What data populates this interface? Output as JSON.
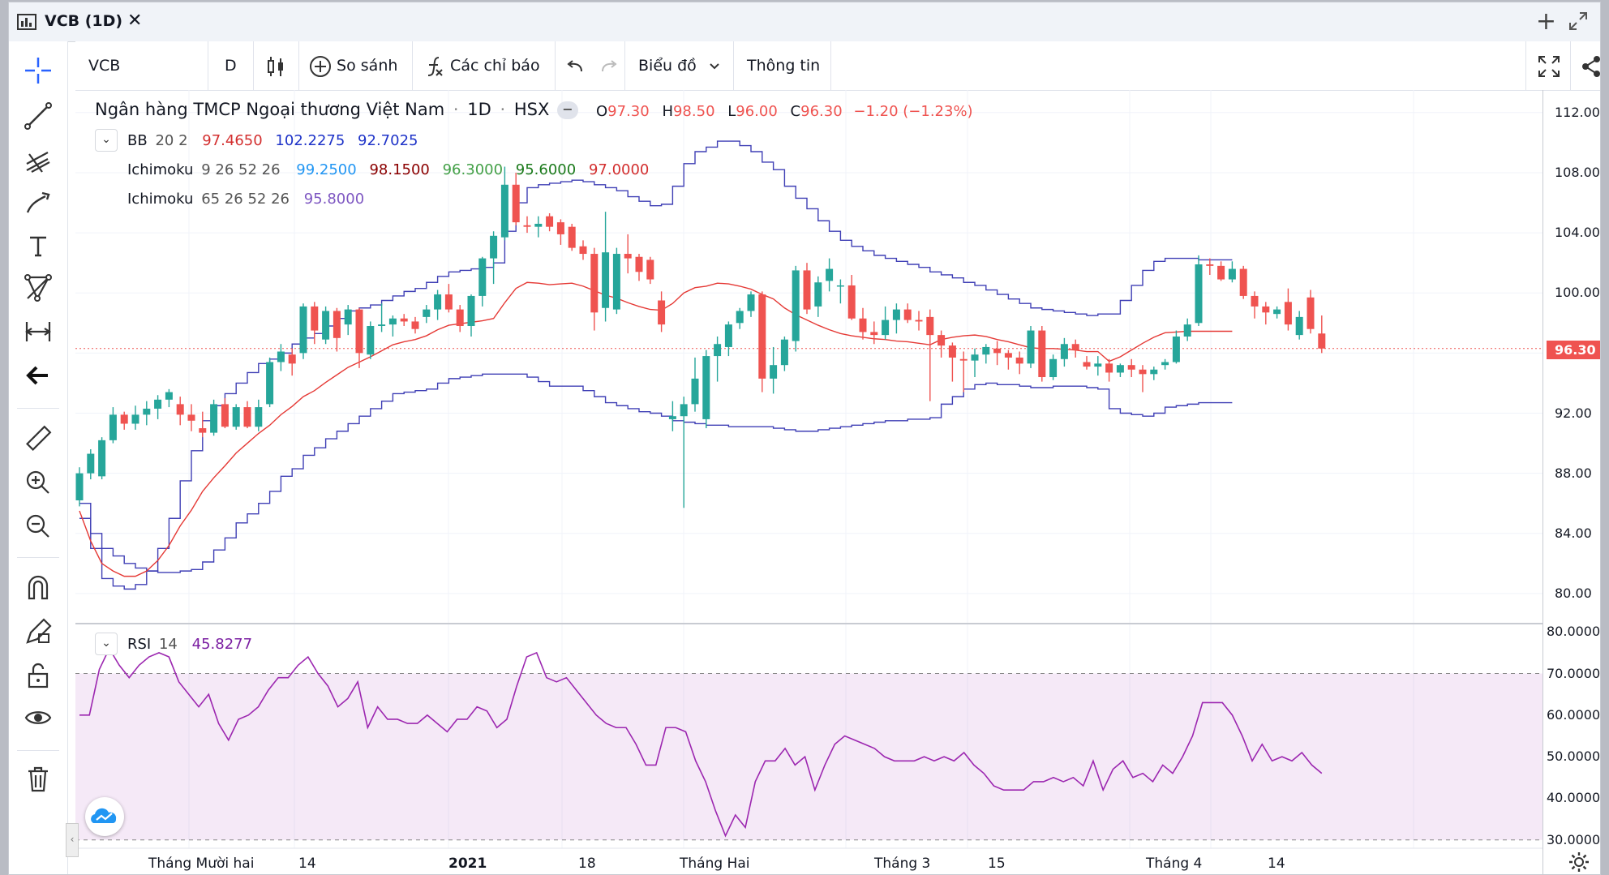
{
  "window": {
    "title": "VCB (1D)",
    "close_label": "✕",
    "add_label": "+"
  },
  "toolbar": {
    "symbol": "VCB",
    "interval": "D",
    "compare_label": "So sánh",
    "indicators_label": "Các chỉ báo",
    "chart_label": "Biểu đồ",
    "info_label": "Thông tin"
  },
  "header": {
    "name": "Ngân hàng TMCP Ngoại thương Việt Nam",
    "interval": "1D",
    "exchange": "HSX",
    "o_label": "O",
    "o_value": "97.30",
    "h_label": "H",
    "h_value": "98.50",
    "l_label": "L",
    "l_value": "96.00",
    "c_label": "C",
    "c_value": "96.30",
    "change": "−1.20 (−1.23%)"
  },
  "indicators": {
    "bb": {
      "name": "BB",
      "params": "20 2",
      "v1": "97.4650",
      "v2": "102.2275",
      "v3": "92.7025"
    },
    "ichi1": {
      "name": "Ichimoku",
      "params": "9 26 52 26",
      "v1": "99.2500",
      "v2": "98.1500",
      "v3": "96.3000",
      "v4": "95.6000",
      "v5": "97.0000"
    },
    "ichi2": {
      "name": "Ichimoku",
      "params": "65 26 52 26",
      "v1": "95.8000"
    },
    "rsi": {
      "name": "RSI",
      "params": "14",
      "v1": "45.8277"
    }
  },
  "price_axis": [
    "112.00",
    "108.00",
    "104.00",
    "100.00",
    "96.00",
    "92.00",
    "88.00",
    "84.00",
    "80.00"
  ],
  "rsi_axis": [
    "80.0000",
    "70.0000",
    "60.0000",
    "50.0000",
    "40.0000",
    "30.0000"
  ],
  "last_price": "96.30",
  "time_axis": [
    "Tháng Mười hai",
    "14",
    "2021",
    "18",
    "Tháng Hai",
    "Tháng 3",
    "15",
    "Tháng 4",
    "14"
  ],
  "colors": {
    "up": "#26a69a",
    "down": "#ef5350",
    "bb": "#3f51b5",
    "rsi": "#9c27b0",
    "accent": "#2962ff"
  },
  "chart_data": {
    "type": "candlestick",
    "symbol": "VCB",
    "ylim": [
      78,
      113.5
    ],
    "rsi_ylim": [
      28,
      82
    ],
    "candles": [
      {
        "o": 86.2,
        "h": 88.4,
        "l": 85.8,
        "c": 88.0
      },
      {
        "o": 88.0,
        "h": 89.6,
        "l": 87.6,
        "c": 89.3
      },
      {
        "o": 87.8,
        "h": 90.4,
        "l": 87.6,
        "c": 90.2
      },
      {
        "o": 90.2,
        "h": 92.4,
        "l": 90.0,
        "c": 91.9
      },
      {
        "o": 91.9,
        "h": 92.1,
        "l": 90.9,
        "c": 91.3
      },
      {
        "o": 91.3,
        "h": 92.5,
        "l": 90.9,
        "c": 91.9
      },
      {
        "o": 91.9,
        "h": 92.8,
        "l": 91.2,
        "c": 92.3
      },
      {
        "o": 92.3,
        "h": 93.2,
        "l": 91.6,
        "c": 92.9
      },
      {
        "o": 92.9,
        "h": 93.6,
        "l": 92.4,
        "c": 93.4
      },
      {
        "o": 92.6,
        "h": 93.1,
        "l": 91.2,
        "c": 91.9
      },
      {
        "o": 91.9,
        "h": 92.6,
        "l": 90.8,
        "c": 91.5
      },
      {
        "o": 91.0,
        "h": 92.1,
        "l": 90.4,
        "c": 90.7
      },
      {
        "o": 90.7,
        "h": 92.9,
        "l": 90.5,
        "c": 92.6
      },
      {
        "o": 92.6,
        "h": 93.0,
        "l": 91.0,
        "c": 91.1
      },
      {
        "o": 91.1,
        "h": 92.6,
        "l": 90.9,
        "c": 92.4
      },
      {
        "o": 92.4,
        "h": 92.8,
        "l": 91.0,
        "c": 91.1
      },
      {
        "o": 91.1,
        "h": 92.9,
        "l": 90.8,
        "c": 92.4
      },
      {
        "o": 92.6,
        "h": 95.7,
        "l": 92.4,
        "c": 95.4
      },
      {
        "o": 95.4,
        "h": 96.6,
        "l": 94.8,
        "c": 96.1
      },
      {
        "o": 95.9,
        "h": 96.3,
        "l": 94.5,
        "c": 95.3
      },
      {
        "o": 96.0,
        "h": 99.3,
        "l": 95.6,
        "c": 99.1
      },
      {
        "o": 99.1,
        "h": 99.4,
        "l": 96.6,
        "c": 97.5
      },
      {
        "o": 96.9,
        "h": 99.1,
        "l": 96.6,
        "c": 98.8
      },
      {
        "o": 98.8,
        "h": 99.0,
        "l": 96.1,
        "c": 97.0
      },
      {
        "o": 97.9,
        "h": 99.2,
        "l": 97.2,
        "c": 98.9
      },
      {
        "o": 98.9,
        "h": 99.0,
        "l": 95.0,
        "c": 96.0
      },
      {
        "o": 95.9,
        "h": 98.1,
        "l": 95.6,
        "c": 97.8
      },
      {
        "o": 97.8,
        "h": 99.3,
        "l": 97.4,
        "c": 97.9
      },
      {
        "o": 97.9,
        "h": 98.5,
        "l": 97.1,
        "c": 98.3
      },
      {
        "o": 98.3,
        "h": 98.6,
        "l": 97.8,
        "c": 98.1
      },
      {
        "o": 98.1,
        "h": 98.4,
        "l": 97.3,
        "c": 97.6
      },
      {
        "o": 98.4,
        "h": 99.2,
        "l": 98.0,
        "c": 98.9
      },
      {
        "o": 98.9,
        "h": 100.2,
        "l": 98.2,
        "c": 99.9
      },
      {
        "o": 99.9,
        "h": 100.6,
        "l": 98.7,
        "c": 98.9
      },
      {
        "o": 98.9,
        "h": 99.2,
        "l": 97.4,
        "c": 97.8
      },
      {
        "o": 97.8,
        "h": 99.9,
        "l": 97.1,
        "c": 99.8
      },
      {
        "o": 99.8,
        "h": 102.4,
        "l": 99.1,
        "c": 102.3
      },
      {
        "o": 102.3,
        "h": 104.1,
        "l": 100.6,
        "c": 103.8
      },
      {
        "o": 103.7,
        "h": 108.4,
        "l": 103.5,
        "c": 107.2
      },
      {
        "o": 107.2,
        "h": 108.0,
        "l": 104.5,
        "c": 104.7
      },
      {
        "o": 104.5,
        "h": 105.1,
        "l": 104.0,
        "c": 104.4
      },
      {
        "o": 104.4,
        "h": 105.1,
        "l": 103.7,
        "c": 104.6
      },
      {
        "o": 105.1,
        "h": 105.3,
        "l": 104.1,
        "c": 104.4
      },
      {
        "o": 104.7,
        "h": 104.9,
        "l": 103.2,
        "c": 103.9
      },
      {
        "o": 104.4,
        "h": 104.6,
        "l": 102.8,
        "c": 103.0
      },
      {
        "o": 103.1,
        "h": 103.5,
        "l": 102.2,
        "c": 102.6
      },
      {
        "o": 102.6,
        "h": 103.0,
        "l": 97.5,
        "c": 98.7
      },
      {
        "o": 99.0,
        "h": 105.4,
        "l": 98.1,
        "c": 102.7
      },
      {
        "o": 98.9,
        "h": 103.0,
        "l": 98.6,
        "c": 102.6
      },
      {
        "o": 102.6,
        "h": 103.9,
        "l": 101.3,
        "c": 102.3
      },
      {
        "o": 102.4,
        "h": 102.6,
        "l": 100.8,
        "c": 101.4
      },
      {
        "o": 102.2,
        "h": 102.4,
        "l": 100.6,
        "c": 100.9
      },
      {
        "o": 99.5,
        "h": 100.1,
        "l": 97.4,
        "c": 97.9
      },
      {
        "o": 91.6,
        "h": 92.8,
        "l": 90.8,
        "c": 91.8
      },
      {
        "o": 91.8,
        "h": 93.1,
        "l": 85.7,
        "c": 92.6
      },
      {
        "o": 92.6,
        "h": 95.7,
        "l": 92.1,
        "c": 94.3
      },
      {
        "o": 91.6,
        "h": 96.2,
        "l": 91.0,
        "c": 95.8
      },
      {
        "o": 95.8,
        "h": 97.1,
        "l": 94.1,
        "c": 96.6
      },
      {
        "o": 96.4,
        "h": 98.1,
        "l": 95.8,
        "c": 97.9
      },
      {
        "o": 98.0,
        "h": 99.0,
        "l": 97.6,
        "c": 98.8
      },
      {
        "o": 98.8,
        "h": 100.1,
        "l": 98.4,
        "c": 99.9
      },
      {
        "o": 99.9,
        "h": 100.1,
        "l": 93.4,
        "c": 94.3
      },
      {
        "o": 94.3,
        "h": 96.4,
        "l": 93.3,
        "c": 95.2
      },
      {
        "o": 95.2,
        "h": 97.1,
        "l": 94.8,
        "c": 96.9
      },
      {
        "o": 96.8,
        "h": 101.8,
        "l": 96.1,
        "c": 101.5
      },
      {
        "o": 101.5,
        "h": 102.0,
        "l": 98.6,
        "c": 98.9
      },
      {
        "o": 99.1,
        "h": 101.1,
        "l": 98.4,
        "c": 100.7
      },
      {
        "o": 100.8,
        "h": 102.3,
        "l": 100.1,
        "c": 101.6
      },
      {
        "o": 100.5,
        "h": 100.9,
        "l": 99.3,
        "c": 100.5
      },
      {
        "o": 100.5,
        "h": 101.2,
        "l": 98.2,
        "c": 98.3
      },
      {
        "o": 98.3,
        "h": 99.0,
        "l": 96.9,
        "c": 97.4
      },
      {
        "o": 97.4,
        "h": 98.1,
        "l": 96.6,
        "c": 97.2
      },
      {
        "o": 97.2,
        "h": 99.1,
        "l": 96.9,
        "c": 98.2
      },
      {
        "o": 98.2,
        "h": 99.3,
        "l": 97.3,
        "c": 98.9
      },
      {
        "o": 98.9,
        "h": 99.3,
        "l": 98.0,
        "c": 98.2
      },
      {
        "o": 98.2,
        "h": 98.8,
        "l": 97.5,
        "c": 98.1
      },
      {
        "o": 98.4,
        "h": 98.9,
        "l": 92.8,
        "c": 97.2
      },
      {
        "o": 97.2,
        "h": 97.5,
        "l": 95.7,
        "c": 96.5
      },
      {
        "o": 96.5,
        "h": 96.7,
        "l": 94.1,
        "c": 95.7
      },
      {
        "o": 95.6,
        "h": 96.1,
        "l": 93.4,
        "c": 95.5
      },
      {
        "o": 95.5,
        "h": 96.3,
        "l": 94.4,
        "c": 95.9
      },
      {
        "o": 95.9,
        "h": 96.6,
        "l": 95.3,
        "c": 96.4
      },
      {
        "o": 96.3,
        "h": 96.8,
        "l": 95.2,
        "c": 96.0
      },
      {
        "o": 96.0,
        "h": 96.2,
        "l": 94.9,
        "c": 95.7
      },
      {
        "o": 95.7,
        "h": 96.1,
        "l": 94.6,
        "c": 95.3
      },
      {
        "o": 95.3,
        "h": 97.8,
        "l": 95.0,
        "c": 97.5
      },
      {
        "o": 97.5,
        "h": 97.8,
        "l": 94.1,
        "c": 94.4
      },
      {
        "o": 94.4,
        "h": 95.9,
        "l": 94.2,
        "c": 95.6
      },
      {
        "o": 95.6,
        "h": 97.0,
        "l": 95.1,
        "c": 96.6
      },
      {
        "o": 96.6,
        "h": 96.9,
        "l": 95.7,
        "c": 96.2
      },
      {
        "o": 95.4,
        "h": 95.8,
        "l": 94.9,
        "c": 95.1
      },
      {
        "o": 95.1,
        "h": 95.8,
        "l": 94.5,
        "c": 95.3
      },
      {
        "o": 95.3,
        "h": 95.6,
        "l": 94.1,
        "c": 94.7
      },
      {
        "o": 94.7,
        "h": 95.3,
        "l": 94.4,
        "c": 95.2
      },
      {
        "o": 95.2,
        "h": 95.6,
        "l": 94.4,
        "c": 94.9
      },
      {
        "o": 94.9,
        "h": 95.2,
        "l": 93.4,
        "c": 94.6
      },
      {
        "o": 94.6,
        "h": 95.1,
        "l": 94.2,
        "c": 94.9
      },
      {
        "o": 95.2,
        "h": 95.6,
        "l": 94.9,
        "c": 95.4
      },
      {
        "o": 95.4,
        "h": 97.5,
        "l": 95.3,
        "c": 97.1
      },
      {
        "o": 97.1,
        "h": 98.3,
        "l": 96.8,
        "c": 97.9
      },
      {
        "o": 98.0,
        "h": 102.5,
        "l": 97.8,
        "c": 101.9
      },
      {
        "o": 101.9,
        "h": 102.3,
        "l": 101.2,
        "c": 101.8
      },
      {
        "o": 101.8,
        "h": 102.1,
        "l": 100.8,
        "c": 100.9
      },
      {
        "o": 100.9,
        "h": 102.1,
        "l": 100.7,
        "c": 101.6
      },
      {
        "o": 101.6,
        "h": 101.8,
        "l": 99.6,
        "c": 99.8
      },
      {
        "o": 99.8,
        "h": 100.1,
        "l": 98.3,
        "c": 99.1
      },
      {
        "o": 99.1,
        "h": 99.4,
        "l": 97.9,
        "c": 98.7
      },
      {
        "o": 98.6,
        "h": 99.1,
        "l": 98.3,
        "c": 98.9
      },
      {
        "o": 99.4,
        "h": 100.3,
        "l": 97.5,
        "c": 97.9
      },
      {
        "o": 97.2,
        "h": 98.8,
        "l": 96.9,
        "c": 98.4
      },
      {
        "o": 99.7,
        "h": 100.2,
        "l": 97.3,
        "c": 97.6
      },
      {
        "o": 97.3,
        "h": 98.5,
        "l": 96.0,
        "c": 96.3
      }
    ],
    "rsi": [
      60,
      60,
      71,
      76,
      72,
      69,
      72,
      74,
      75,
      74,
      68,
      65,
      62,
      65,
      58,
      54,
      59,
      60,
      62,
      66,
      69,
      69,
      72,
      74,
      70,
      67,
      62,
      64,
      68,
      57,
      62,
      59,
      59,
      58,
      58,
      60,
      58,
      56,
      59,
      59,
      62,
      61,
      57,
      59,
      67,
      74,
      75,
      69,
      68,
      69,
      66,
      63,
      60,
      58,
      57,
      57,
      53,
      48,
      48,
      57,
      57,
      56,
      49,
      44,
      37,
      31,
      36,
      33,
      44,
      49,
      49,
      52,
      48,
      50,
      42,
      48,
      53,
      55,
      54,
      53,
      52,
      50,
      49,
      49,
      49,
      50,
      49,
      50,
      49,
      51,
      48,
      46,
      43,
      42,
      42,
      42,
      44,
      44,
      45,
      44,
      45,
      43,
      49,
      42,
      47,
      49,
      45,
      46,
      44,
      48,
      46,
      50,
      55,
      63,
      63,
      63,
      60,
      55,
      49,
      53,
      49,
      50,
      49,
      51,
      48,
      46
    ],
    "bb_upper": [
      86.0,
      83.0,
      81.0,
      80.5,
      80.3,
      80.6,
      81.5,
      83.0,
      85.0,
      87.5,
      89.5,
      91.5,
      92.5,
      93.3,
      94.0,
      94.7,
      95.3,
      95.6,
      96.0,
      96.6,
      97.0,
      97.3,
      97.8,
      98.3,
      98.8,
      99.0,
      99.2,
      99.5,
      99.8,
      100.1,
      100.3,
      100.7,
      101.1,
      101.4,
      101.5,
      101.6,
      101.7,
      102.0,
      104.1,
      106.0,
      107.0,
      107.2,
      107.3,
      107.4,
      107.5,
      107.4,
      107.2,
      107.0,
      106.8,
      106.4,
      106.1,
      105.8,
      105.9,
      107.1,
      108.6,
      109.4,
      109.7,
      110.1,
      110.1,
      109.8,
      109.4,
      108.7,
      108.2,
      107.1,
      106.3,
      105.6,
      104.8,
      104.1,
      103.5,
      103.1,
      102.8,
      102.5,
      102.3,
      102.1,
      101.9,
      101.7,
      101.4,
      101.2,
      101.0,
      100.7,
      100.5,
      100.2,
      99.9,
      99.6,
      99.3,
      99.0,
      98.9,
      98.8,
      98.7,
      98.6,
      98.5,
      98.6,
      98.6,
      99.5,
      100.5,
      101.5,
      102.1,
      102.3,
      102.3,
      102.3,
      102.2,
      102.2,
      102.2,
      102.2
    ],
    "bb_lower": [
      85.0,
      84.0,
      83.0,
      82.5,
      82.0,
      81.7,
      81.5,
      81.4,
      81.4,
      81.5,
      81.6,
      82.1,
      82.9,
      83.7,
      84.7,
      85.3,
      86.0,
      86.8,
      87.8,
      88.3,
      89.2,
      89.7,
      90.3,
      90.8,
      91.3,
      91.8,
      92.3,
      92.8,
      93.3,
      93.4,
      93.5,
      93.6,
      94.0,
      94.3,
      94.4,
      94.5,
      94.6,
      94.6,
      94.6,
      94.6,
      94.4,
      94.1,
      93.8,
      93.8,
      93.8,
      93.5,
      93.1,
      92.7,
      92.5,
      92.3,
      92.1,
      92.0,
      91.8,
      91.5,
      91.4,
      91.3,
      91.2,
      91.2,
      91.1,
      91.1,
      91.1,
      91.1,
      91.0,
      90.9,
      90.8,
      90.8,
      90.9,
      91.0,
      91.1,
      91.2,
      91.3,
      91.4,
      91.5,
      91.5,
      91.6,
      91.6,
      91.7,
      92.6,
      93.1,
      93.6,
      93.9,
      94.0,
      93.9,
      93.9,
      93.8,
      93.7,
      93.7,
      93.8,
      93.8,
      93.8,
      93.7,
      93.6,
      92.3,
      92.0,
      91.9,
      91.8,
      92.0,
      92.4,
      92.5,
      92.6,
      92.7,
      92.7,
      92.7,
      92.7
    ]
  }
}
